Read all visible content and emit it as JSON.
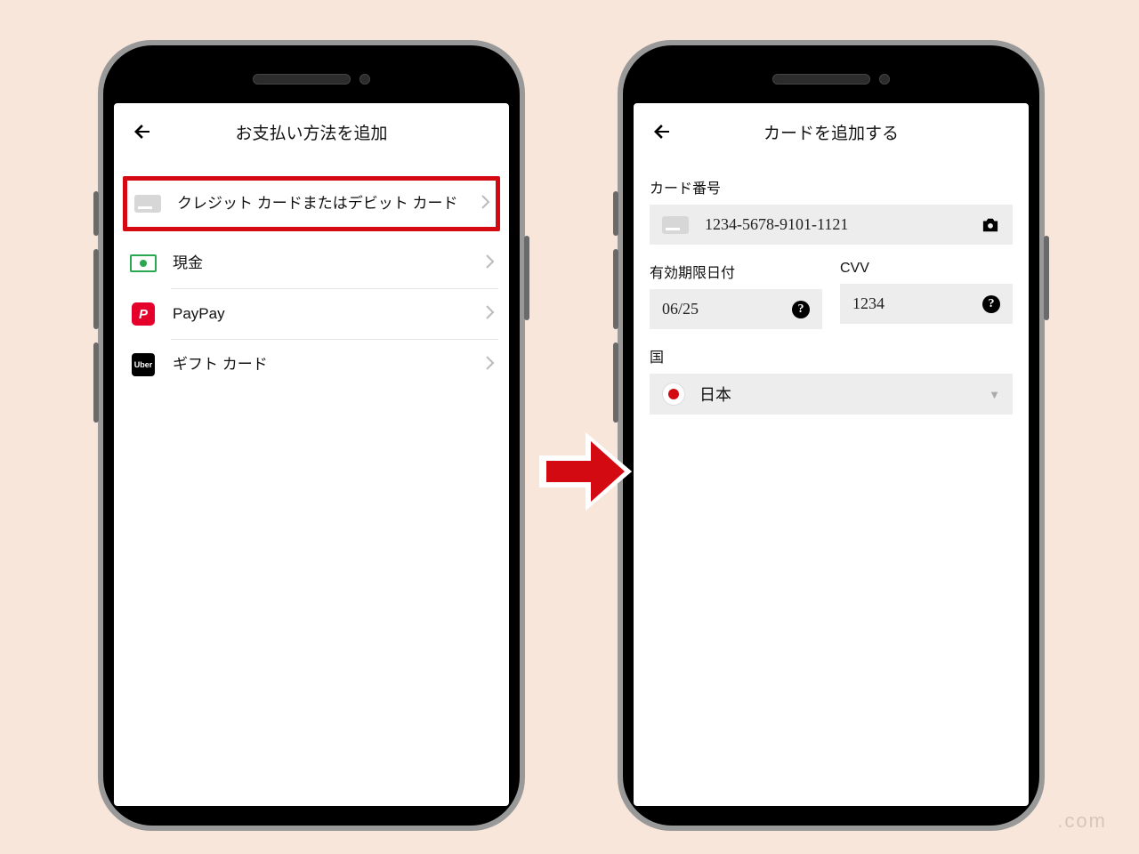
{
  "colors": {
    "accent_red": "#d40a12",
    "paypay_red": "#e4002b",
    "cash_green": "#2aa851"
  },
  "left": {
    "title": "お支払い方法を追加",
    "options": {
      "card": "クレジット カードまたはデビット カード",
      "cash": "現金",
      "paypay": "PayPay",
      "gift": "ギフト カード"
    }
  },
  "right": {
    "title": "カードを追加する",
    "labels": {
      "card_number": "カード番号",
      "expiry": "有効期限日付",
      "cvv": "CVV",
      "country": "国"
    },
    "values": {
      "card_number": "1234-5678-9101-1121",
      "expiry": "06/25",
      "cvv": "1234",
      "country": "日本"
    }
  },
  "watermark": ".com",
  "icons": {
    "uber_text": "Uber",
    "paypay_glyph": "P"
  }
}
